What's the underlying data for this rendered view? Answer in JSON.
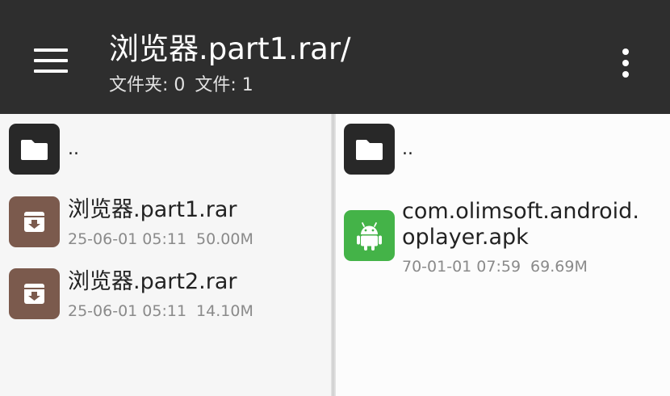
{
  "header": {
    "title": "浏览器.part1.rar/",
    "folders_label": "文件夹: 0",
    "files_label": "文件: 1"
  },
  "left_pane": {
    "parent_label": "..",
    "files": [
      {
        "name": "浏览器.part1.rar",
        "date": "25-06-01 05:11",
        "size": "50.00M",
        "icon": "archive-icon"
      },
      {
        "name": "浏览器.part2.rar",
        "date": "25-06-01 05:11",
        "size": "14.10M",
        "icon": "archive-icon"
      }
    ]
  },
  "right_pane": {
    "parent_label": "..",
    "files": [
      {
        "name": "com.olimsoft.android.oplayer.apk",
        "date": "70-01-01 07:59",
        "size": "69.69M",
        "icon": "android-icon"
      }
    ]
  },
  "colors": {
    "appbar": "#2e2e2e",
    "folder_tile": "#282828",
    "archive_tile": "#7b5a4d",
    "apk_tile": "#44b348"
  }
}
